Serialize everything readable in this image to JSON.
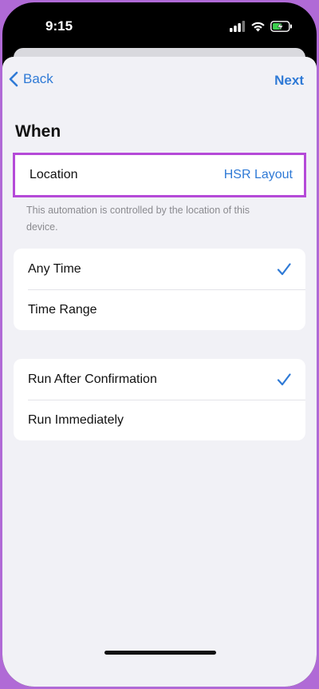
{
  "statusbar": {
    "time": "9:15",
    "icons": [
      "cellular-signal-icon",
      "wifi-icon",
      "battery-charging-icon"
    ]
  },
  "nav": {
    "back_label": "Back",
    "next_label": "Next"
  },
  "section": {
    "title": "When"
  },
  "location": {
    "label": "Location",
    "value": "HSR Layout",
    "footnote": "This automation is controlled by the location of this device."
  },
  "time_options": [
    {
      "label": "Any Time",
      "selected": true
    },
    {
      "label": "Time Range",
      "selected": false
    }
  ],
  "run_options": [
    {
      "label": "Run After Confirmation",
      "selected": true
    },
    {
      "label": "Run Immediately",
      "selected": false
    }
  ],
  "colors": {
    "accent": "#2f7ad6",
    "highlight_border": "#b54ad8",
    "sheet_bg": "#f1f1f6"
  }
}
